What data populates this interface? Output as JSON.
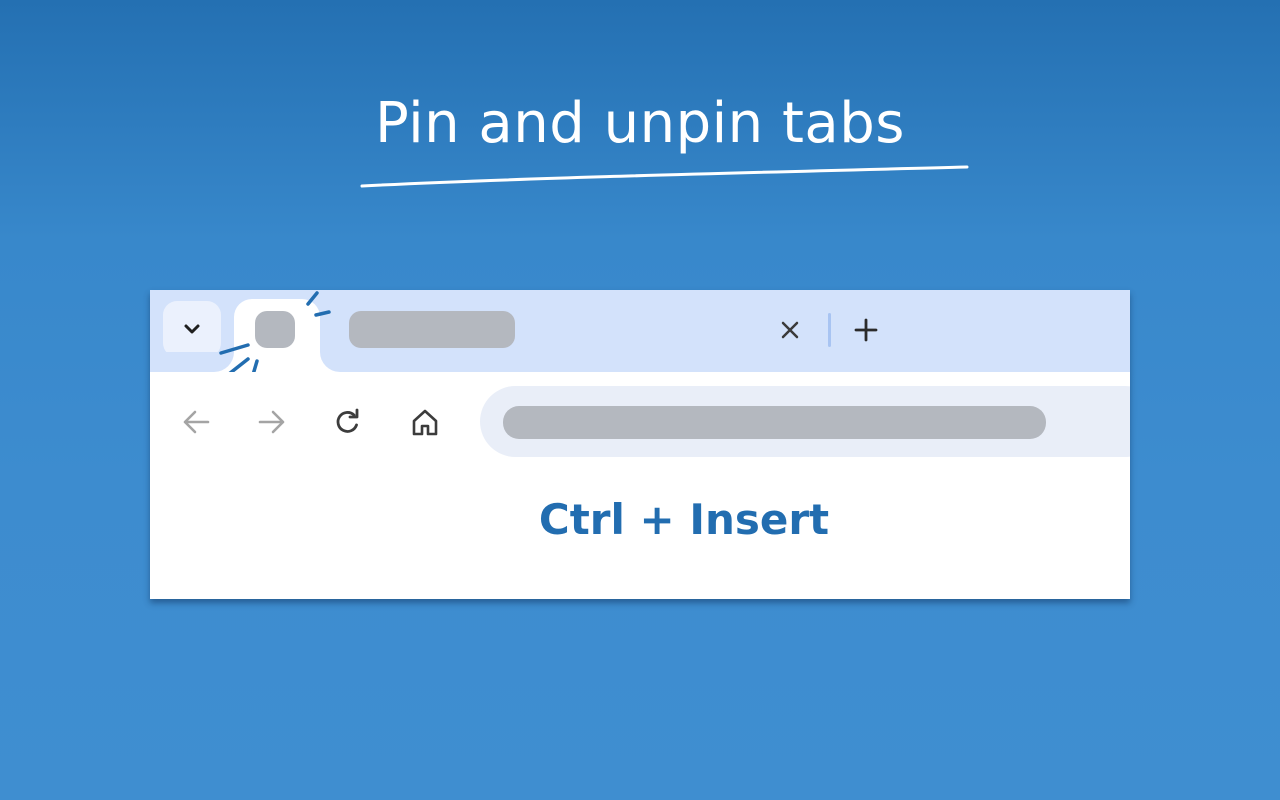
{
  "headline": "Pin and unpin tabs",
  "shortcut": "Ctrl + Insert",
  "colors": {
    "background": "#3d8ccf",
    "tabstrip": "#d3e2fb",
    "placeholder": "#b4b8bf",
    "omnibox": "#e9eef8",
    "accent": "#226db0"
  },
  "icons": {
    "tab_search": "chevron-down-icon",
    "tab_close": "close-icon",
    "new_tab": "plus-icon",
    "back": "arrow-left-icon",
    "forward": "arrow-right-icon",
    "reload": "reload-icon",
    "home": "home-icon"
  }
}
